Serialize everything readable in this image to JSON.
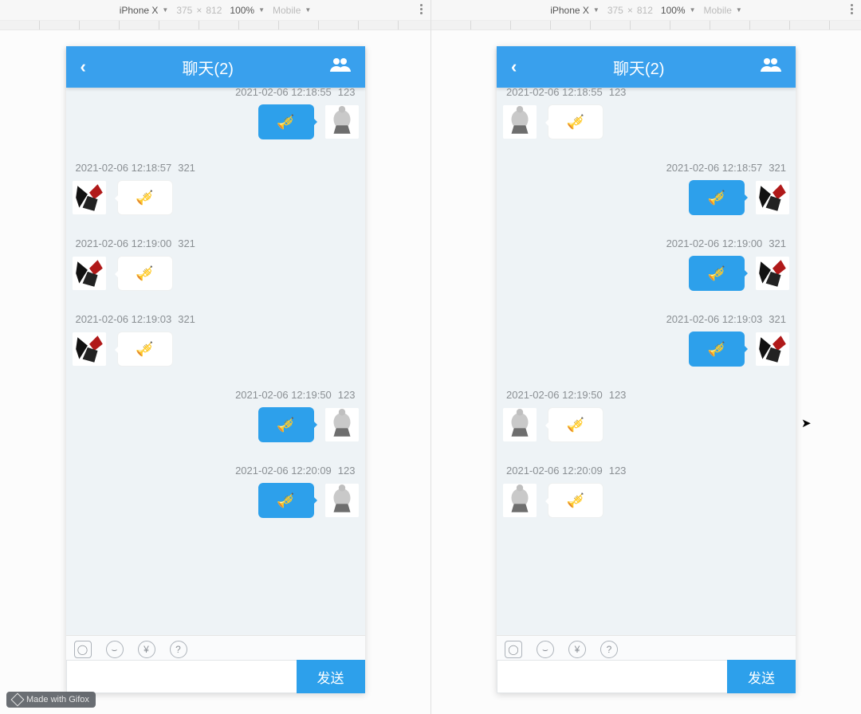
{
  "devtools": {
    "device": "iPhone X",
    "width": "375",
    "height": "812",
    "times": "×",
    "zoom": "100%",
    "mode": "Mobile"
  },
  "header": {
    "title": "聊天(2)"
  },
  "emoji": "🎺",
  "footer": {
    "send_label": "发送",
    "icons": {
      "camera": "camera-icon",
      "smile": "smile-icon",
      "yuan": "yuan-icon",
      "help": "help-icon"
    }
  },
  "watermark": "Made with Gifox",
  "left_panel": {
    "messages": [
      {
        "side": "self",
        "meta": "2021-02-06 12:18:55",
        "user": "123",
        "bubble": "blue",
        "avatar": "a1",
        "cut": true
      },
      {
        "side": "other",
        "meta": "2021-02-06 12:18:57",
        "user": "321",
        "bubble": "white",
        "avatar": "a2"
      },
      {
        "side": "other",
        "meta": "2021-02-06 12:19:00",
        "user": "321",
        "bubble": "white",
        "avatar": "a2"
      },
      {
        "side": "other",
        "meta": "2021-02-06 12:19:03",
        "user": "321",
        "bubble": "white",
        "avatar": "a2"
      },
      {
        "side": "self",
        "meta": "2021-02-06 12:19:50",
        "user": "123",
        "bubble": "blue",
        "avatar": "a1"
      },
      {
        "side": "self",
        "meta": "2021-02-06 12:20:09",
        "user": "123",
        "bubble": "blue",
        "avatar": "a1"
      }
    ]
  },
  "right_panel": {
    "messages": [
      {
        "side": "other",
        "meta": "2021-02-06 12:18:55",
        "user": "123",
        "bubble": "white",
        "avatar": "a1",
        "cut": true
      },
      {
        "side": "self",
        "meta": "2021-02-06 12:18:57",
        "user": "321",
        "bubble": "blue",
        "avatar": "a2"
      },
      {
        "side": "self",
        "meta": "2021-02-06 12:19:00",
        "user": "321",
        "bubble": "blue",
        "avatar": "a2"
      },
      {
        "side": "self",
        "meta": "2021-02-06 12:19:03",
        "user": "321",
        "bubble": "blue",
        "avatar": "a2"
      },
      {
        "side": "other",
        "meta": "2021-02-06 12:19:50",
        "user": "123",
        "bubble": "white",
        "avatar": "a1"
      },
      {
        "side": "other",
        "meta": "2021-02-06 12:20:09",
        "user": "123",
        "bubble": "white",
        "avatar": "a1"
      }
    ]
  }
}
